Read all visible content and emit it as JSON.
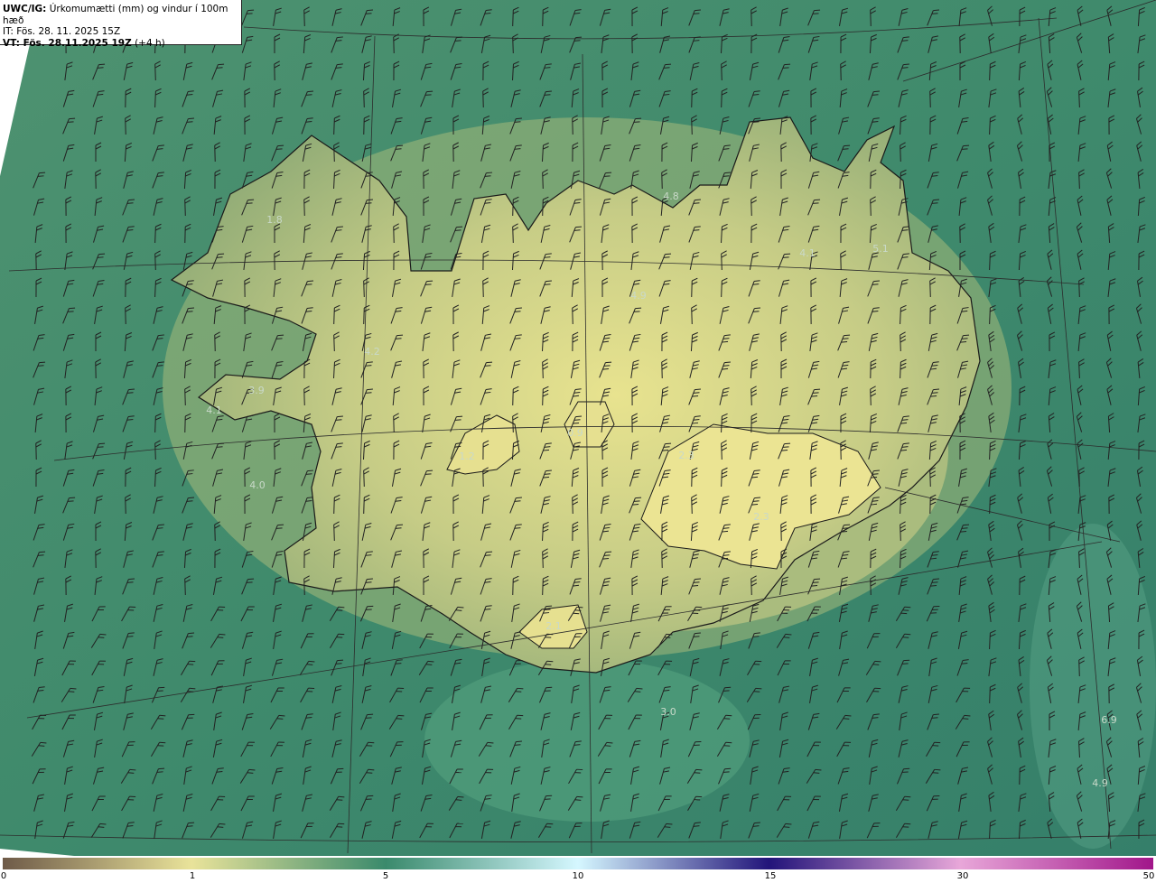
{
  "header": {
    "product_label": "UWC/IG:",
    "product_desc": "Úrkomumætti (mm) og vindur í 100m hæð",
    "initial_time": "IT: Fös. 28. 11. 2025 15Z",
    "valid_label": "VT: Fös. 28.11.2025 19Z",
    "valid_offset": "(+4 h)"
  },
  "colors": {
    "ocean": "#3f8a6c",
    "land_low": "#9fb37a",
    "land_high": "#e7e38e",
    "coast": "#1a1a1a",
    "grid": "#2c2c2c",
    "barb": "#222222"
  },
  "value_labels": [
    "4.8",
    "5.1",
    "1.8",
    "4.1",
    "4.9",
    "4.2",
    "3.9",
    "0.9",
    "1.2",
    "4.0",
    "2.3",
    "2.3",
    "3.0",
    "6.9",
    "4.9",
    "2.1",
    "4.1"
  ],
  "colorbar": {
    "ticks": [
      "0",
      "1",
      "5",
      "10",
      "15",
      "30",
      "50"
    ],
    "stops": [
      {
        "value": "0",
        "color": "#6e5a48"
      },
      {
        "value": "1",
        "color": "#e9e39a"
      },
      {
        "value": "5",
        "color": "#3a8a6c"
      },
      {
        "value": "10",
        "color": "#d5f7ff"
      },
      {
        "value": "15",
        "color": "#22147a"
      },
      {
        "value": "30",
        "color": "#e8a7d9"
      },
      {
        "value": "50",
        "color": "#a1168a"
      }
    ]
  }
}
